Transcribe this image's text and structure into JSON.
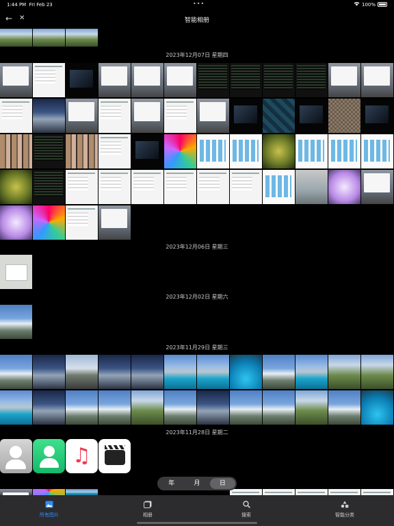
{
  "status_bar": {
    "time": "1:44 PM",
    "date": "Fri Feb 23",
    "dots": "•••",
    "wifi_icon": "wifi-icon",
    "battery": "100%"
  },
  "nav": {
    "title": "智能相册",
    "back_icon": "←",
    "close_icon": "✕"
  },
  "sections": [
    {
      "title": "2023年12月07日 星期四"
    },
    {
      "title": "2023年12月06日 星期三"
    },
    {
      "title": "2023年12月02日 星期六"
    },
    {
      "title": "2023年11月29日 星期三"
    },
    {
      "title": "2023年11月28日 星期二"
    }
  ],
  "view_switcher": {
    "options": [
      "年",
      "月",
      "日"
    ],
    "selected": "日"
  },
  "tabs": [
    {
      "label": "所有图片",
      "icon": "photos-icon",
      "active": true
    },
    {
      "label": "相册",
      "icon": "album-icon",
      "active": false
    },
    {
      "label": "搜索",
      "icon": "search-icon",
      "active": false
    },
    {
      "label": "智能分类",
      "icon": "smart-category-icon",
      "active": false
    }
  ],
  "colors": {
    "background": "#000000",
    "tab_bar": "#2c2c2e",
    "accent": "#2f8cff",
    "segmented_bg": "#3a3a3c"
  }
}
